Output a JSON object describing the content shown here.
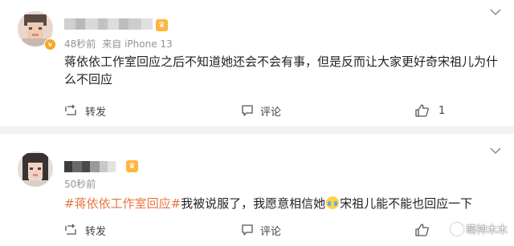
{
  "colors": {
    "accent": "#eb7340",
    "meta": "#939393",
    "badge": "#f5a623"
  },
  "comments": [
    {
      "time": "48秒前",
      "source": "来自 iPhone 13",
      "text": "蒋依依工作室回应之后不知道她还会不会有事，但是反而让大家更好奇宋祖儿为什么不回应",
      "repost_label": "转发",
      "comment_label": "评论",
      "like_count": "1",
      "avatar_icon": "blurred-avatar",
      "name_blurred": true
    },
    {
      "time": "50秒前",
      "hashtag": "#蒋依依工作室回应#",
      "text_before_emoji": "我被说服了，我愿意相信她",
      "emoji": "crying-face-emoji",
      "text_after_emoji": "宋祖儿能不能也回应一下",
      "repost_label": "转发",
      "comment_label": "评论",
      "avatar_icon": "blurred-avatar",
      "name_blurred": true
    }
  ],
  "watermark": "萌神木木"
}
